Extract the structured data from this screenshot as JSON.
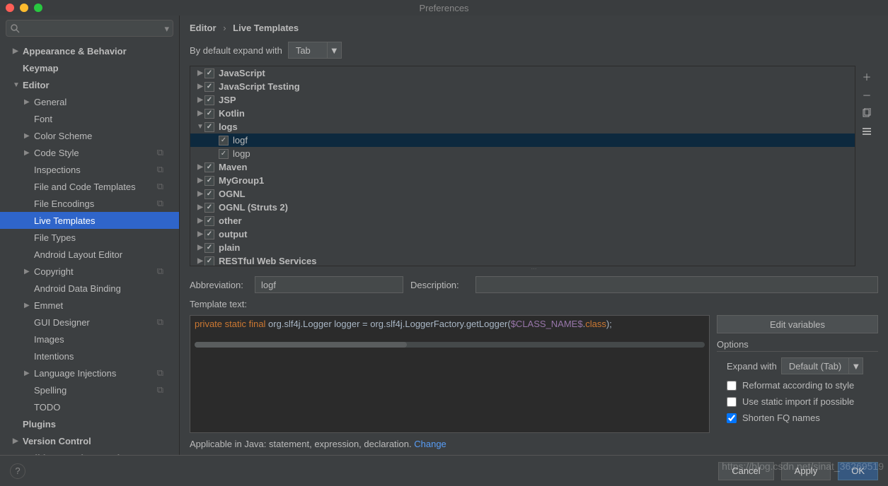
{
  "window": {
    "title": "Preferences"
  },
  "breadcrumb": {
    "root": "Editor",
    "current": "Live Templates"
  },
  "sidebar": {
    "search_placeholder": "",
    "items": [
      {
        "label": "Appearance & Behavior",
        "bold": true,
        "arrow": "right",
        "level": 0
      },
      {
        "label": "Keymap",
        "bold": true,
        "level": 0,
        "noarrow": true
      },
      {
        "label": "Editor",
        "bold": true,
        "arrow": "down",
        "level": 0
      },
      {
        "label": "General",
        "arrow": "right",
        "level": 1
      },
      {
        "label": "Font",
        "level": 1,
        "noarrow": true
      },
      {
        "label": "Color Scheme",
        "arrow": "right",
        "level": 1
      },
      {
        "label": "Code Style",
        "arrow": "right",
        "level": 1,
        "copy": true
      },
      {
        "label": "Inspections",
        "level": 1,
        "noarrow": true,
        "copy": true
      },
      {
        "label": "File and Code Templates",
        "level": 1,
        "noarrow": true,
        "copy": true
      },
      {
        "label": "File Encodings",
        "level": 1,
        "noarrow": true,
        "copy": true
      },
      {
        "label": "Live Templates",
        "level": 1,
        "noarrow": true,
        "selected": true
      },
      {
        "label": "File Types",
        "level": 1,
        "noarrow": true
      },
      {
        "label": "Android Layout Editor",
        "level": 1,
        "noarrow": true
      },
      {
        "label": "Copyright",
        "arrow": "right",
        "level": 1,
        "copy": true
      },
      {
        "label": "Android Data Binding",
        "level": 1,
        "noarrow": true
      },
      {
        "label": "Emmet",
        "arrow": "right",
        "level": 1
      },
      {
        "label": "GUI Designer",
        "level": 1,
        "noarrow": true,
        "copy": true
      },
      {
        "label": "Images",
        "level": 1,
        "noarrow": true
      },
      {
        "label": "Intentions",
        "level": 1,
        "noarrow": true
      },
      {
        "label": "Language Injections",
        "arrow": "right",
        "level": 1,
        "copy": true
      },
      {
        "label": "Spelling",
        "level": 1,
        "noarrow": true,
        "copy": true
      },
      {
        "label": "TODO",
        "level": 1,
        "noarrow": true
      },
      {
        "label": "Plugins",
        "bold": true,
        "level": 0,
        "noarrow": true
      },
      {
        "label": "Version Control",
        "bold": true,
        "arrow": "right",
        "level": 0
      },
      {
        "label": "Build, Execution, Deployment",
        "bold": true,
        "arrow": "right",
        "level": 0
      }
    ]
  },
  "expand": {
    "label": "By default expand with",
    "value": "Tab"
  },
  "tree": [
    {
      "label": "JavaScript",
      "depth": 0,
      "arrow": "right",
      "checked": true
    },
    {
      "label": "JavaScript Testing",
      "depth": 0,
      "arrow": "right",
      "checked": true
    },
    {
      "label": "JSP",
      "depth": 0,
      "arrow": "right",
      "checked": true
    },
    {
      "label": "Kotlin",
      "depth": 0,
      "arrow": "right",
      "checked": true
    },
    {
      "label": "logs",
      "depth": 0,
      "arrow": "down",
      "checked": true
    },
    {
      "label": "logf",
      "depth": 1,
      "checked": true,
      "selected": true
    },
    {
      "label": "logp",
      "depth": 1,
      "checked": true
    },
    {
      "label": "Maven",
      "depth": 0,
      "arrow": "right",
      "checked": true
    },
    {
      "label": "MyGroup1",
      "depth": 0,
      "arrow": "right",
      "checked": true
    },
    {
      "label": "OGNL",
      "depth": 0,
      "arrow": "right",
      "checked": true
    },
    {
      "label": "OGNL (Struts 2)",
      "depth": 0,
      "arrow": "right",
      "checked": true
    },
    {
      "label": "other",
      "depth": 0,
      "arrow": "right",
      "checked": true
    },
    {
      "label": "output",
      "depth": 0,
      "arrow": "right",
      "checked": true
    },
    {
      "label": "plain",
      "depth": 0,
      "arrow": "right",
      "checked": true
    },
    {
      "label": "RESTful Web Services",
      "depth": 0,
      "arrow": "right",
      "checked": true
    }
  ],
  "form": {
    "abbr_label": "Abbreviation:",
    "abbr_value": "logf",
    "desc_label": "Description:",
    "desc_value": "",
    "template_label": "Template text:",
    "template_code": {
      "p1": "private static final",
      "p2": " org.slf4j.Logger logger = org.slf4j.LoggerFactory.getLogger(",
      "p3": "$CLASS_NAME$",
      "p4": ".",
      "p5": "class",
      "p6": ");"
    },
    "edit_vars": "Edit variables",
    "options_title": "Options",
    "expand_with": "Expand with",
    "expand_value": "Default (Tab)",
    "opt_reformat": "Reformat according to style",
    "opt_static": "Use static import if possible",
    "opt_shorten": "Shorten FQ names"
  },
  "applicable": {
    "text": "Applicable in Java: statement, expression, declaration. ",
    "link": "Change"
  },
  "footer": {
    "cancel": "Cancel",
    "apply": "Apply",
    "ok": "OK"
  },
  "watermark": "https://blog.csdn.net/sinat_36269519"
}
